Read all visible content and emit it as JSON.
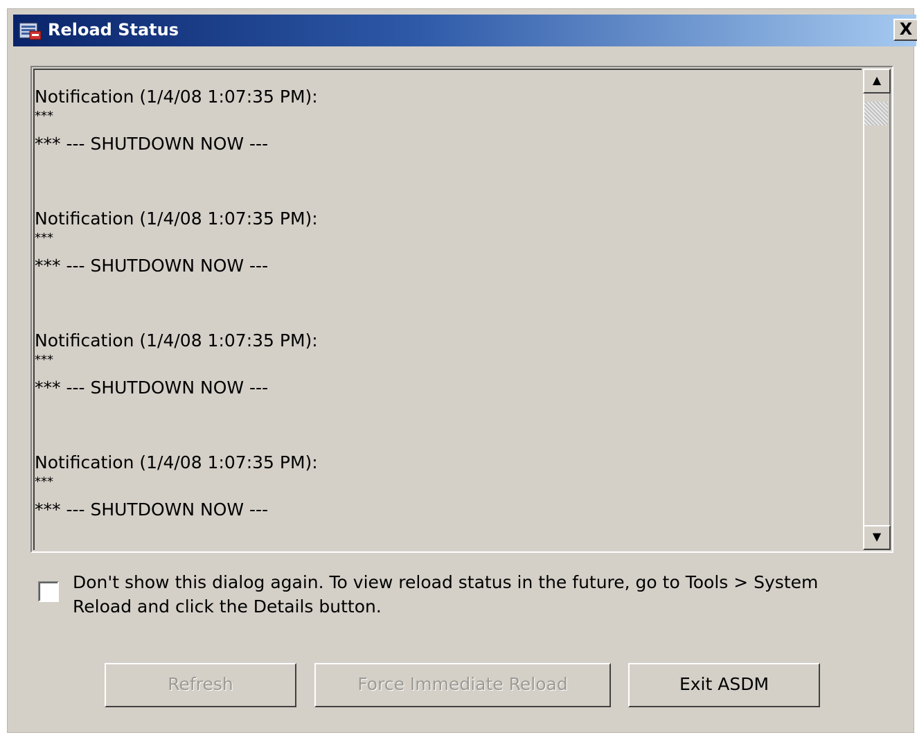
{
  "window": {
    "title": "Reload Status",
    "icon": "asdm-app-icon",
    "close_label": "X"
  },
  "log": {
    "entries": [
      {
        "heading": "Notification (1/4/08 1:07:35 PM):",
        "line2": "***",
        "line3": "*** --- SHUTDOWN NOW ---"
      },
      {
        "heading": "Notification (1/4/08 1:07:35 PM):",
        "line2": "***",
        "line3": "*** --- SHUTDOWN NOW ---"
      },
      {
        "heading": "Notification (1/4/08 1:07:35 PM):",
        "line2": "***",
        "line3": "*** --- SHUTDOWN NOW ---"
      },
      {
        "heading": "Notification (1/4/08 1:07:35 PM):",
        "line2": "***",
        "line3": "*** --- SHUTDOWN NOW ---"
      }
    ],
    "scroll_up_icon": "▲",
    "scroll_down_icon": "▼"
  },
  "options": {
    "dont_show_checked": false,
    "dont_show_label": "Don't show this dialog again. To view reload status in the future, go to Tools > System Reload and click the Details button."
  },
  "buttons": {
    "refresh": {
      "label": "Refresh",
      "enabled": false
    },
    "force": {
      "label": "Force Immediate Reload",
      "enabled": false
    },
    "exit": {
      "label": "Exit ASDM",
      "enabled": true
    }
  }
}
